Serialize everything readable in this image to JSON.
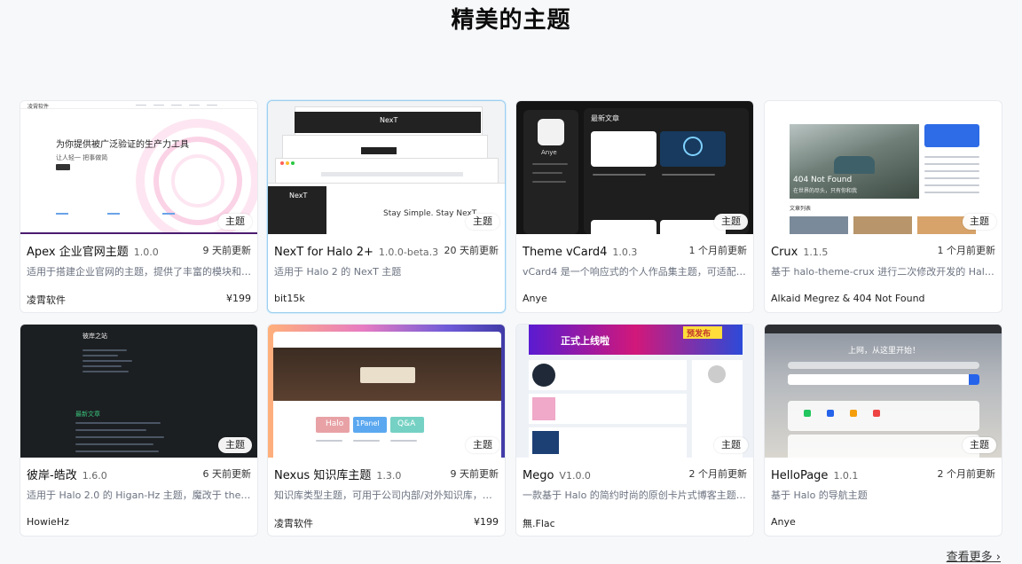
{
  "page": {
    "title": "精美的主题",
    "more_label": "查看更多 ›"
  },
  "colors": {
    "accent": "#3b82f6",
    "card_border_active": "#9ccff0",
    "background": "#f7f8fa"
  },
  "themes": [
    {
      "name": "Apex 企业官网主题",
      "version": "1.0.0",
      "updated": "9 天前更新",
      "description": "适用于搭建企业官网的主题，提供了丰富的模块和…",
      "author": "凌霄软件",
      "price": "¥199",
      "badge": "主题",
      "preview": {
        "brand": "凌霄软件",
        "headline": "为你提供被广泛验证的生产力工具",
        "sub": "让人轻一    把事做简"
      }
    },
    {
      "name": "NexT for Halo 2+",
      "version": "1.0.0-beta.3",
      "updated": "20 天前更新",
      "description": "适用于 Halo 2 的 NexT 主题",
      "author": "bit15k",
      "price": "",
      "badge": "主题",
      "preview": {
        "logo": "NexT",
        "tagline": "Stay Simple. Stay NexT."
      }
    },
    {
      "name": "Theme vCard4",
      "version": "1.0.3",
      "updated": "1 个月前更新",
      "description": "vCard4 是一个响应式的个人作品集主题，可适配所…",
      "author": "Anye",
      "price": "",
      "badge": "主题",
      "preview": {
        "heading": "最新文章",
        "profile": "Anye"
      }
    },
    {
      "name": "Crux",
      "version": "1.1.5",
      "updated": "1 个月前更新",
      "description": "基于 halo-theme-crux 进行二次修改开发的 Halo …",
      "author": "Alkaid Megrez & 404 Not Found",
      "price": "",
      "badge": "主题",
      "preview": {
        "hero": "404 Not Found",
        "hero_sub": "在世界的尽头，只有你和我",
        "list_title": "文章列表"
      }
    },
    {
      "name": "彼岸-皓改",
      "version": "1.6.0",
      "updated": "6 天前更新",
      "description": "适用于 Halo 2.0 的 Higan-Hz 主题，魔改于 them…",
      "author": "HowieHz",
      "price": "",
      "badge": "主题",
      "preview": {
        "site": "彼岸之站",
        "section": "最新文章"
      }
    },
    {
      "name": "Nexus 知识库主题",
      "version": "1.3.0",
      "updated": "9 天前更新",
      "description": "知识库类型主题，可用于公司内部/对外知识库，…",
      "author": "凌霄软件",
      "price": "¥199",
      "badge": "主题",
      "preview": {
        "tiles": [
          "Halo",
          "1Panel",
          "Q&A"
        ]
      }
    },
    {
      "name": "Mego",
      "version": "V1.0.0",
      "updated": "2 个月前更新",
      "description": "一款基于 Halo 的简约时尚的原创卡片式博客主题…",
      "author": "無.Flac",
      "price": "",
      "badge": "主题",
      "preview": {
        "banner": "正式上线啦",
        "tag": "预发布"
      }
    },
    {
      "name": "HelloPage",
      "version": "1.0.1",
      "updated": "2 个月前更新",
      "description": "基于 Halo 的导航主题",
      "author": "Anye",
      "price": "",
      "badge": "主题",
      "preview": {
        "hero": "上网，从这里开始！"
      }
    }
  ]
}
